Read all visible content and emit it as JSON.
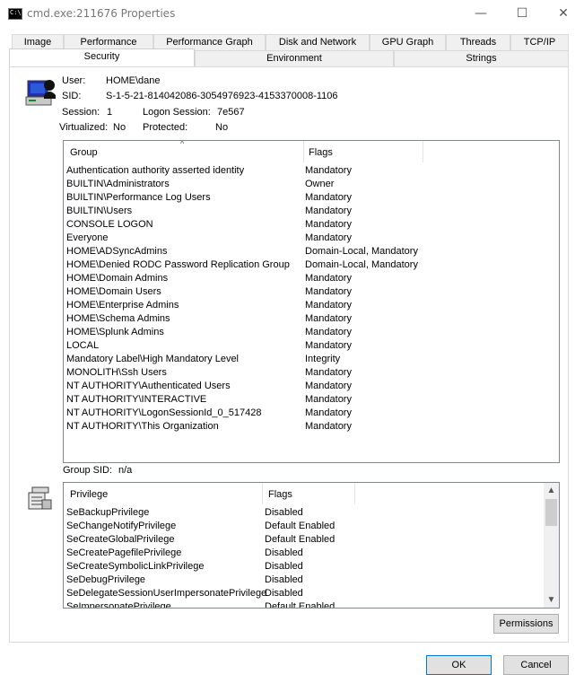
{
  "window": {
    "title": "cmd.exe:211676 Properties",
    "minimize_glyph": "—",
    "maximize_glyph": "☐",
    "close_glyph": "✕",
    "app_icon": "console-icon",
    "app_icon_text": "C:\\."
  },
  "tabs_row1": [
    "Image",
    "Performance",
    "Performance Graph",
    "Disk and Network",
    "GPU Graph",
    "Threads",
    "TCP/IP"
  ],
  "tabs_row2": [
    "Security",
    "Environment",
    "Strings"
  ],
  "active_tab": "Security",
  "info": {
    "user_label": "User:",
    "user_value": "HOME\\dane",
    "sid_label": "SID:",
    "sid_value": "S-1-5-21-814042086-3054976923-4153370008-1106",
    "session_label": "Session:",
    "session_value": "1",
    "logon_label": "Logon Session:",
    "logon_value": "7e567",
    "virtualized_label": "Virtualized:",
    "virtualized_value": "No",
    "protected_label": "Protected:",
    "protected_value": "No"
  },
  "groups": {
    "col_group": "Group",
    "col_flags": "Flags",
    "sort_indicator": "^",
    "rows": [
      {
        "group": "Authentication authority asserted identity",
        "flags": "Mandatory"
      },
      {
        "group": "BUILTIN\\Administrators",
        "flags": "Owner"
      },
      {
        "group": "BUILTIN\\Performance Log Users",
        "flags": "Mandatory"
      },
      {
        "group": "BUILTIN\\Users",
        "flags": "Mandatory"
      },
      {
        "group": "CONSOLE LOGON",
        "flags": "Mandatory"
      },
      {
        "group": "Everyone",
        "flags": "Mandatory"
      },
      {
        "group": "HOME\\ADSyncAdmins",
        "flags": "Domain-Local, Mandatory"
      },
      {
        "group": "HOME\\Denied RODC Password Replication Group",
        "flags": "Domain-Local, Mandatory"
      },
      {
        "group": "HOME\\Domain Admins",
        "flags": "Mandatory"
      },
      {
        "group": "HOME\\Domain Users",
        "flags": "Mandatory"
      },
      {
        "group": "HOME\\Enterprise Admins",
        "flags": "Mandatory"
      },
      {
        "group": "HOME\\Schema Admins",
        "flags": "Mandatory"
      },
      {
        "group": "HOME\\Splunk Admins",
        "flags": "Mandatory"
      },
      {
        "group": "LOCAL",
        "flags": "Mandatory"
      },
      {
        "group": "Mandatory Label\\High Mandatory Level",
        "flags": "Integrity"
      },
      {
        "group": "MONOLITH\\Ssh Users",
        "flags": "Mandatory"
      },
      {
        "group": "NT AUTHORITY\\Authenticated Users",
        "flags": "Mandatory"
      },
      {
        "group": "NT AUTHORITY\\INTERACTIVE",
        "flags": "Mandatory"
      },
      {
        "group": "NT AUTHORITY\\LogonSessionId_0_517428",
        "flags": "Mandatory"
      },
      {
        "group": "NT AUTHORITY\\This Organization",
        "flags": "Mandatory"
      }
    ]
  },
  "group_sid": {
    "label": "Group SID:",
    "value": "n/a"
  },
  "privileges": {
    "col_privilege": "Privilege",
    "col_flags": "Flags",
    "scroll_up": "▲",
    "scroll_down": "▼",
    "rows": [
      {
        "privilege": "SeBackupPrivilege",
        "flags": "Disabled"
      },
      {
        "privilege": "SeChangeNotifyPrivilege",
        "flags": "Default Enabled"
      },
      {
        "privilege": "SeCreateGlobalPrivilege",
        "flags": "Default Enabled"
      },
      {
        "privilege": "SeCreatePagefilePrivilege",
        "flags": "Disabled"
      },
      {
        "privilege": "SeCreateSymbolicLinkPrivilege",
        "flags": "Disabled"
      },
      {
        "privilege": "SeDebugPrivilege",
        "flags": "Disabled"
      },
      {
        "privilege": "SeDelegateSessionUserImpersonatePrivilege",
        "flags": "Disabled"
      },
      {
        "privilege": "SeImpersonatePrivilege",
        "flags": "Default Enabled"
      }
    ]
  },
  "buttons": {
    "permissions": "Permissions",
    "ok": "OK",
    "cancel": "Cancel"
  }
}
